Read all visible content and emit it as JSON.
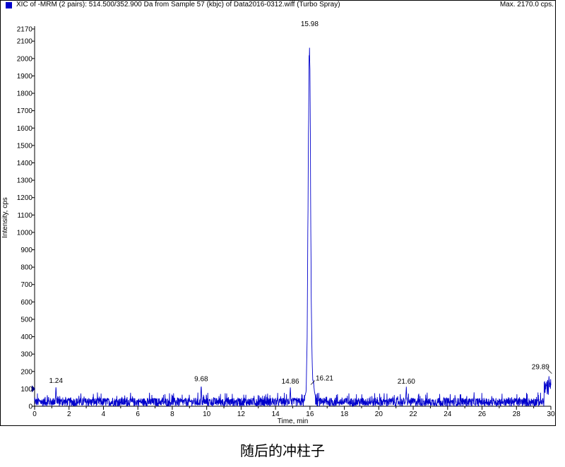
{
  "header": {
    "title": "XIC of -MRM (2 pairs): 514.500/352.900 Da  from Sample 57 (kbjc) of Data2016-0312.wiff (Turbo Spray)",
    "max_label": "Max. 2170.0 cps."
  },
  "caption": "随后的冲柱子",
  "colors": {
    "series": "#0000cc",
    "axis": "#000000",
    "background": "#ffffff"
  },
  "chart_data": {
    "type": "line",
    "xlabel": "Time, min",
    "ylabel": "Intensity, cps",
    "xlim": [
      0,
      30
    ],
    "ylim": [
      0,
      2170
    ],
    "x_ticks": [
      0,
      2,
      4,
      6,
      8,
      10,
      12,
      14,
      16,
      18,
      20,
      22,
      24,
      26,
      28,
      30
    ],
    "y_ticks": [
      0,
      100,
      200,
      300,
      400,
      500,
      600,
      700,
      800,
      900,
      1000,
      1100,
      1200,
      1300,
      1400,
      1500,
      1600,
      1700,
      1800,
      1900,
      2000,
      2100,
      2170
    ],
    "baseline_noise_range": [
      0,
      80
    ],
    "peaks": [
      {
        "label": "1.24",
        "x": 1.24,
        "y": 110
      },
      {
        "label": "9.68",
        "x": 9.68,
        "y": 120
      },
      {
        "label": "14.86",
        "x": 14.86,
        "y": 105
      },
      {
        "label": "15.98",
        "x": 15.98,
        "y": 2170
      },
      {
        "label": "16.21",
        "x": 16.21,
        "y": 140
      },
      {
        "label": "21.60",
        "x": 21.6,
        "y": 105
      },
      {
        "label": "29.89",
        "x": 29.89,
        "y": 180
      }
    ],
    "main_peak_profile": [
      [
        15.7,
        60
      ],
      [
        15.78,
        90
      ],
      [
        15.84,
        420
      ],
      [
        15.88,
        1100
      ],
      [
        15.92,
        1720
      ],
      [
        15.95,
        2070
      ],
      [
        15.98,
        2170
      ],
      [
        16.01,
        1900
      ],
      [
        16.04,
        1200
      ],
      [
        16.08,
        600
      ],
      [
        16.12,
        300
      ],
      [
        16.16,
        160
      ],
      [
        16.21,
        140
      ],
      [
        16.26,
        90
      ],
      [
        16.32,
        60
      ]
    ]
  }
}
